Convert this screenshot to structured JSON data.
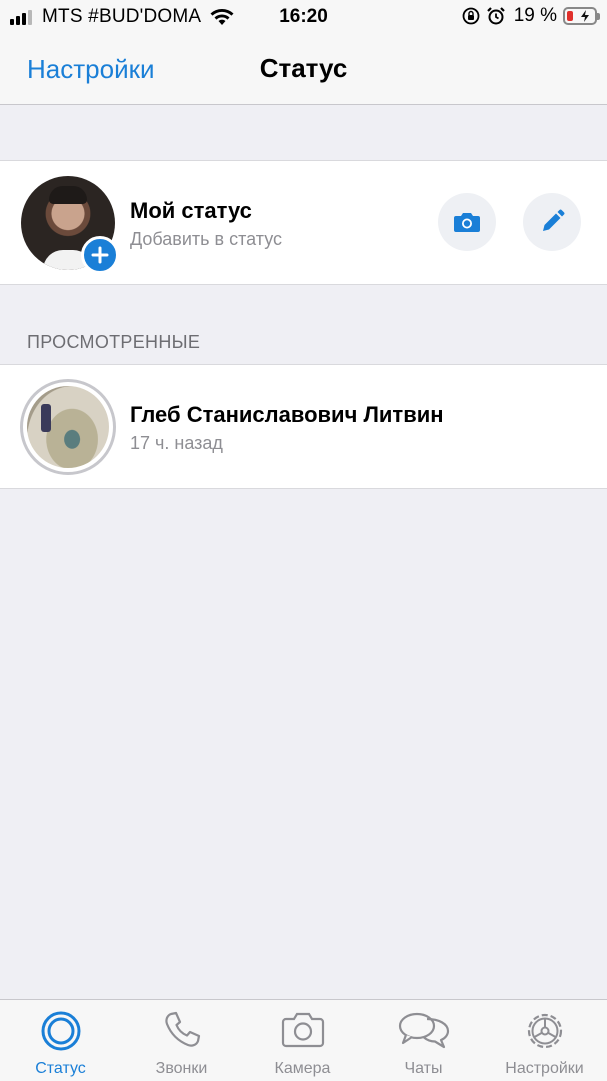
{
  "status_bar": {
    "carrier": "MTS #BUD'DOMA",
    "time": "16:20",
    "battery_percent": "19 %"
  },
  "nav": {
    "back_label": "Настройки",
    "title": "Статус"
  },
  "my_status": {
    "name": "Мой статус",
    "subtitle": "Добавить в статус"
  },
  "viewed_section": {
    "header": "ПРОСМОТРЕННЫЕ",
    "items": [
      {
        "name": "Глеб Станиславович Литвин",
        "time": "17 ч. назад"
      }
    ]
  },
  "tabs": [
    {
      "label": "Статус",
      "icon": "status-icon",
      "active": true
    },
    {
      "label": "Звонки",
      "icon": "phone-icon",
      "active": false
    },
    {
      "label": "Камера",
      "icon": "camera-icon",
      "active": false
    },
    {
      "label": "Чаты",
      "icon": "chats-icon",
      "active": false
    },
    {
      "label": "Настройки",
      "icon": "settings-icon",
      "active": false
    }
  ],
  "colors": {
    "accent": "#1a7fd7",
    "inactive": "#8e8e93",
    "battery_low": "#e0302b"
  }
}
